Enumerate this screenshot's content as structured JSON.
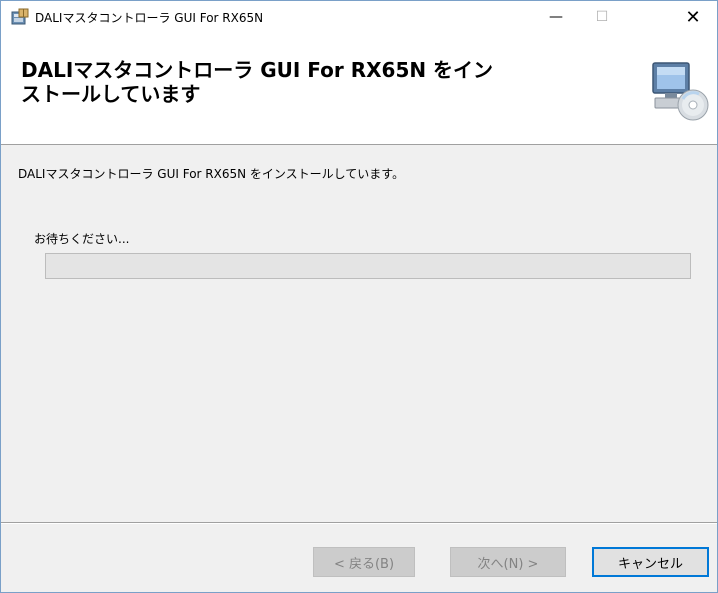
{
  "window": {
    "title": "DALIマスタコントローラ GUI For RX65N",
    "app_icon": "installer-icon",
    "controls": {
      "minimize": "—",
      "maximize": "☐",
      "close": "✕"
    }
  },
  "header": {
    "title_line1": "DALIマスタコントローラ GUI For RX65N をイン",
    "title_line2": "ストールしています",
    "icon": "computer-cd-icon"
  },
  "main": {
    "description": "DALIマスタコントローラ GUI For RX65N をインストールしています。",
    "wait_label": "お待ちください...",
    "progress": 0
  },
  "footer": {
    "back_label": "< 戻る(B)",
    "next_label": "次へ(N) >",
    "cancel_label": "キャンセル"
  },
  "colors": {
    "accent": "#0078d7",
    "progress_track": "#e4e4e4",
    "window_bg": "#f0f0f0"
  }
}
